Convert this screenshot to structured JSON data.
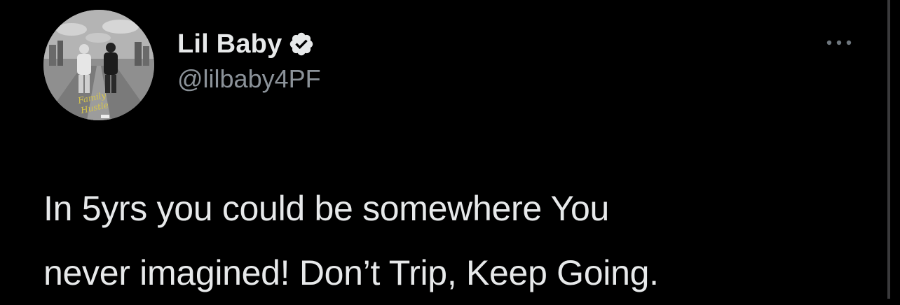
{
  "author": {
    "display_name": "Lil Baby",
    "handle": "@lilbaby4PF",
    "verified": true
  },
  "icons": {
    "verified": "verified-badge-icon",
    "more": "more-options-icon"
  },
  "tweet": {
    "text": "In 5yrs you could be somewhere You\nnever imagined!  Don’t Trip, Keep Going."
  },
  "colors": {
    "background": "#000000",
    "text": "#e7e9ea",
    "secondary_text": "#8b9299",
    "badge": "#e7e9ea"
  }
}
